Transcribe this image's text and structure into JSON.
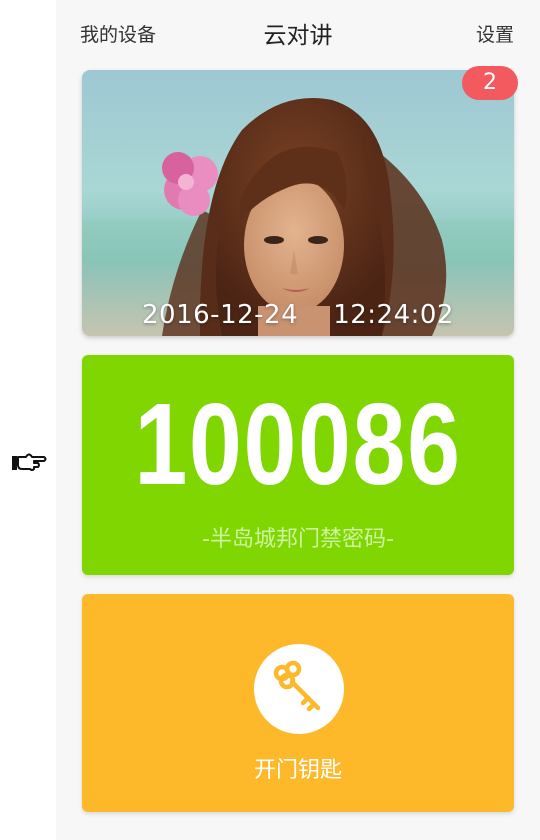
{
  "header": {
    "left_link": "我的设备",
    "title": "云对讲",
    "right_link": "设置"
  },
  "photo_card": {
    "date": "2016-12-24",
    "time": "12:24:02",
    "badge_count": "2"
  },
  "code_card": {
    "code": "100086",
    "caption": "-半岛城邦门禁密码-"
  },
  "key_card": {
    "label": "开门钥匙",
    "icon": "key-icon"
  },
  "colors": {
    "badge": "#f25a5f",
    "code_card": "#7fd600",
    "key_card": "#fdb92a"
  }
}
